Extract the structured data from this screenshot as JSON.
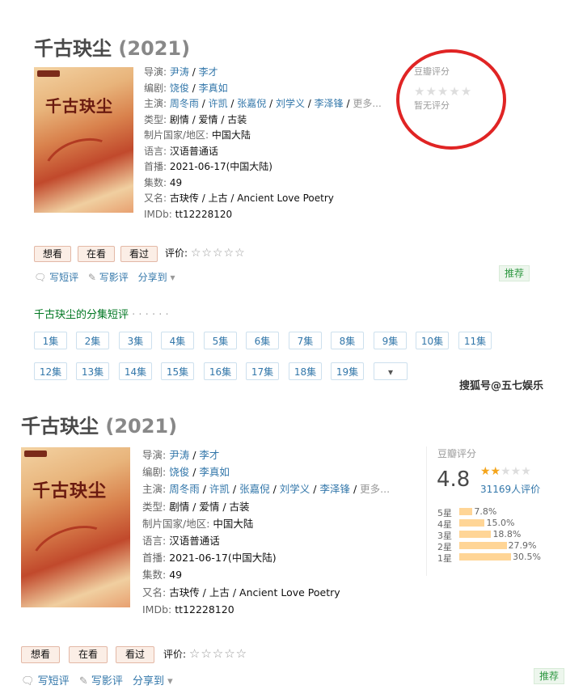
{
  "top": {
    "title": "千古玦尘",
    "year": "(2021)",
    "info": {
      "director_label": "导演:",
      "directors": [
        "尹涛",
        "李才"
      ],
      "writer_label": "编剧:",
      "writers": [
        "饶俊",
        "李真如"
      ],
      "cast_label": "主演:",
      "cast": [
        "周冬雨",
        "许凯",
        "张嘉倪",
        "刘学义",
        "李泽锋"
      ],
      "cast_more": "更多...",
      "genre_label": "类型:",
      "genre": "剧情 / 爱情 / 古装",
      "region_label": "制片国家/地区:",
      "region": "中国大陆",
      "language_label": "语言:",
      "language": "汉语普通话",
      "premiere_label": "首播:",
      "premiere": "2021-06-17(中国大陆)",
      "episodes_label": "集数:",
      "episodes": "49",
      "aka_label": "又名:",
      "aka": "古玦传 / 上古 / Ancient Love Poetry",
      "imdb_label": "IMDb:",
      "imdb": "tt12228120"
    },
    "rating": {
      "label": "豆瓣评分",
      "stars": "★★★★★",
      "none_text": "暂无评分"
    },
    "actions": {
      "want": "想看",
      "watching": "在看",
      "watched": "看过",
      "rate_label": "评价:",
      "rate_stars": "☆☆☆☆☆"
    },
    "links": {
      "short_review": "写短评",
      "review": "写影评",
      "share": "分享到"
    },
    "recommend": "推荐",
    "episode_section_title": "千古玦尘的分集短评",
    "episode_section_dots": "· · · · · ·",
    "episodes_list": [
      "1集",
      "2集",
      "3集",
      "4集",
      "5集",
      "6集",
      "7集",
      "8集",
      "9集",
      "10集",
      "11集",
      "12集",
      "13集",
      "14集",
      "15集",
      "16集",
      "17集",
      "18集",
      "19集"
    ],
    "more_arrow": "▾"
  },
  "watermark": "搜狐号@五七娱乐",
  "bottom": {
    "title": "千古玦尘",
    "year": "(2021)",
    "rating": {
      "label": "豆瓣评分",
      "score": "4.8",
      "stars_full": "★★",
      "stars_rest": "★★★",
      "count": "31169人评价",
      "distribution": [
        {
          "label": "5星",
          "pct": "7.8%",
          "value": 7.8
        },
        {
          "label": "4星",
          "pct": "15.0%",
          "value": 15.0
        },
        {
          "label": "3星",
          "pct": "18.8%",
          "value": 18.8
        },
        {
          "label": "2星",
          "pct": "27.9%",
          "value": 27.9
        },
        {
          "label": "1星",
          "pct": "30.5%",
          "value": 30.5
        }
      ]
    },
    "actions": {
      "want": "想看",
      "watching": "在看",
      "watched": "看过",
      "rate_label": "评价:",
      "rate_stars": "☆☆☆☆☆"
    },
    "links": {
      "short_review": "写短评",
      "review": "写影评",
      "share": "分享到"
    },
    "recommend": "推荐"
  },
  "colors": {
    "link": "#3377aa",
    "highlight_circle": "#e02424",
    "bar": "#ffd596",
    "star_active": "#f4a51c"
  }
}
